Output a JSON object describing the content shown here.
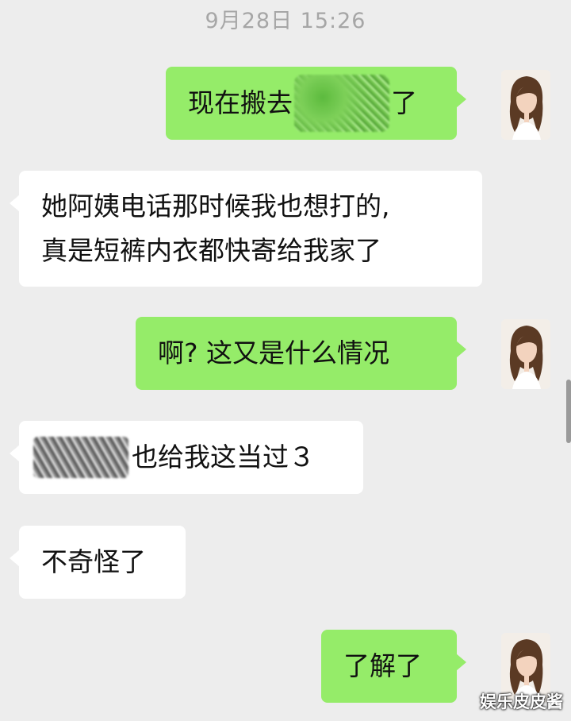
{
  "chat": {
    "timestamp": "9月28日 15:26",
    "messages": [
      {
        "side": "out",
        "before": "现在搬去",
        "after": "了",
        "redacted": true
      },
      {
        "side": "in",
        "line1": "她阿姨电话那时候我也想打的,",
        "line2": "真是短裤内衣都快寄给我家了"
      },
      {
        "side": "out",
        "text": "啊? 这又是什么情况"
      },
      {
        "side": "in",
        "text": "也给我这当过３",
        "redacted": true
      },
      {
        "side": "in",
        "text": "不奇怪了"
      },
      {
        "side": "out",
        "text": "了解了"
      }
    ]
  },
  "watermark": "娱乐皮皮酱",
  "colors": {
    "background": "#ededed",
    "outgoing_bubble": "#95ec69",
    "incoming_bubble": "#ffffff"
  }
}
